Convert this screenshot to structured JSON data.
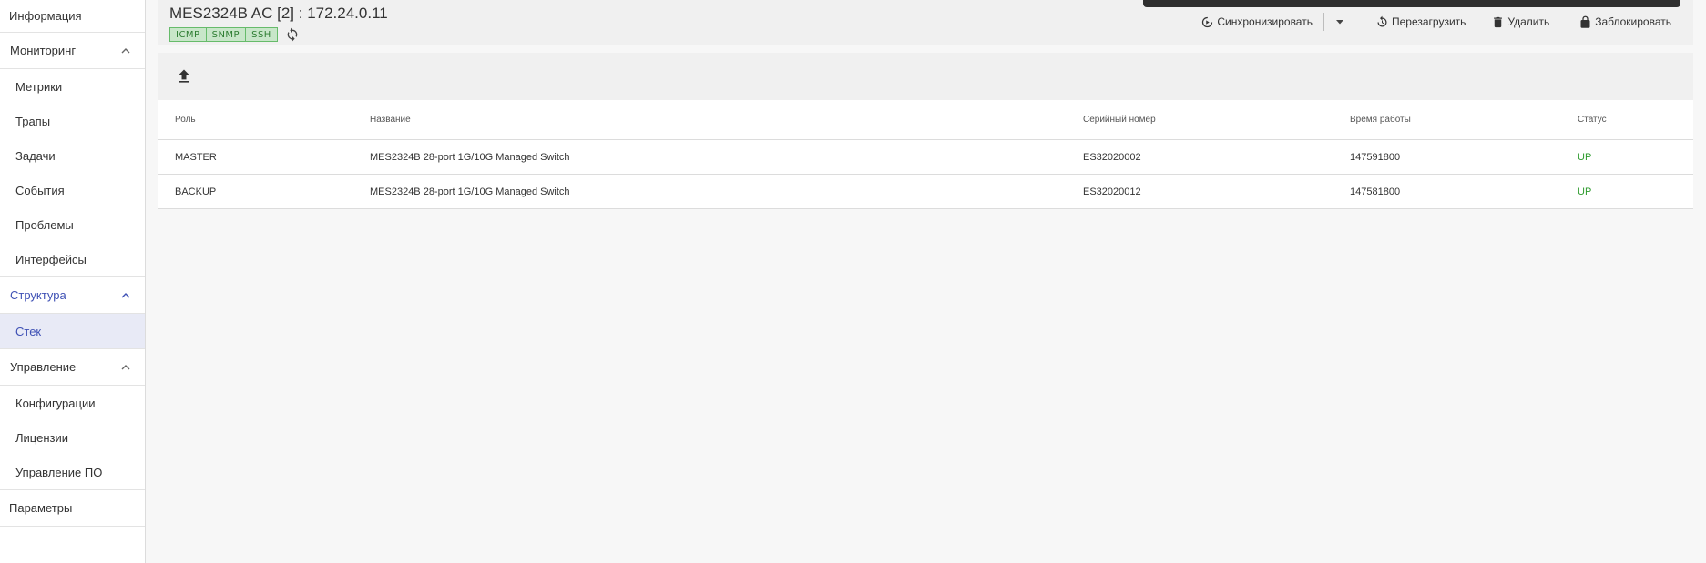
{
  "sidebar": {
    "info": "Информация",
    "monitoring": {
      "label": "Мониторинг",
      "items": [
        "Метрики",
        "Трапы",
        "Задачи",
        "События",
        "Проблемы",
        "Интерфейсы"
      ]
    },
    "structure": {
      "label": "Структура",
      "items": [
        "Стек"
      ]
    },
    "management": {
      "label": "Управление",
      "items": [
        "Конфигурации",
        "Лицензии",
        "Управление ПО"
      ]
    },
    "params": "Параметры"
  },
  "header": {
    "title": "MES2324B AC [2] : 172.24.0.11",
    "badges": [
      "ICMP",
      "SNMP",
      "SSH"
    ]
  },
  "actions": {
    "sync": "Синхронизировать",
    "reboot": "Перезагрузить",
    "delete": "Удалить",
    "lock": "Заблокировать"
  },
  "table": {
    "columns": [
      "Роль",
      "Название",
      "Серийный номер",
      "Время работы",
      "Статус"
    ],
    "rows": [
      [
        "MASTER",
        "MES2324B 28-port 1G/10G Managed Switch",
        "ES32020002",
        "147591800",
        "UP"
      ],
      [
        "BACKUP",
        "MES2324B 28-port 1G/10G Managed Switch",
        "ES32020012",
        "147581800",
        "UP"
      ]
    ]
  },
  "colors": {
    "accent": "#3f51b5",
    "status_up": "#2e9b2e",
    "badge_bg": "#c8e6c9"
  },
  "icons": {
    "sync": "sync-icon",
    "reboot": "reboot-icon",
    "delete": "trash-icon",
    "lock": "lock-icon",
    "upload": "upload-icon",
    "refresh": "refresh-icon"
  }
}
